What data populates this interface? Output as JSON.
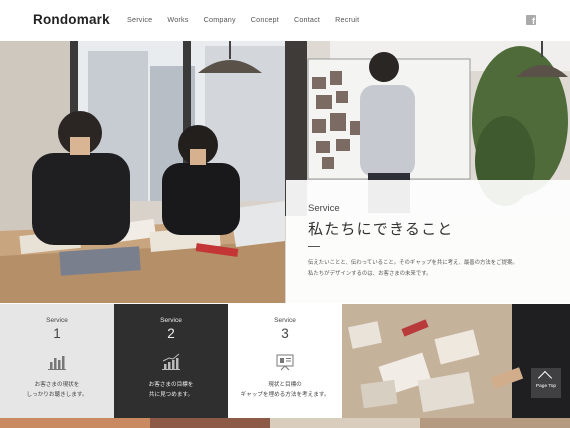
{
  "brand": {
    "logo": "Rondomark"
  },
  "nav": [
    {
      "label": "Service"
    },
    {
      "label": "Works"
    },
    {
      "label": "Company"
    },
    {
      "label": "Concept"
    },
    {
      "label": "Contact"
    },
    {
      "label": "Recruit"
    }
  ],
  "social": {
    "facebook_glyph": "f",
    "icon": "facebook-icon"
  },
  "service_panel": {
    "label": "Service",
    "title": "私たちにできること",
    "description_line1": "伝えたいことと、伝わっていること。そのギャップを共に考え、最善の方法をご提案。",
    "description_line2": "私たちがデザインするのは、お客さまの未来です。"
  },
  "service_cards": [
    {
      "label": "Service",
      "number": "1",
      "icon": "bar-chart-icon",
      "line1": "お客さまの現状を",
      "line2": "しっかりお聴きします。"
    },
    {
      "label": "Service",
      "number": "2",
      "icon": "growth-chart-icon",
      "line1": "お客さまの目標を",
      "line2": "共に見つめます。"
    },
    {
      "label": "Service",
      "number": "3",
      "icon": "presentation-board-icon",
      "line1": "現状と目標の",
      "line2": "ギャップを埋める方法を考えます。"
    }
  ],
  "page_top": {
    "label": "Page Top"
  },
  "colors": {
    "dark_card": "#2f2f2f",
    "light_card": "#e6e6e6",
    "text": "#333333"
  }
}
